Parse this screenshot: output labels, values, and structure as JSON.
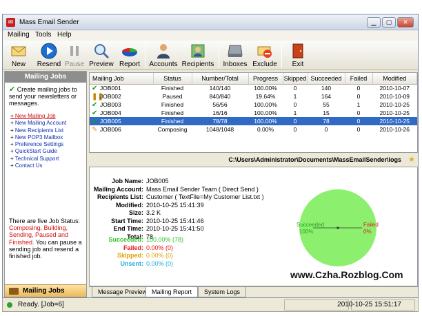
{
  "window": {
    "title": "Mass Email Sender"
  },
  "menu": [
    "Mailing",
    "Tools",
    "Help"
  ],
  "toolbar": {
    "new": "New",
    "resend": "Resend",
    "pause": "Pause",
    "preview": "Preview",
    "report": "Report",
    "accounts": "Accounts",
    "recipients": "Recipients",
    "inboxes": "Inboxes",
    "exclude": "Exclude",
    "exit": "Exit"
  },
  "left_panel": {
    "header": "Mailing Jobs",
    "intro": "Create mailing jobs to send your newsletters or messages.",
    "links": [
      "New Mailing Job",
      "New Mailing Account",
      "New Recipients List",
      "New POP3 Mailbox",
      "Preference Settings",
      "QuickStart Guide",
      "Technical Support",
      "Contact Us"
    ],
    "status_intro": "There are five Job Status:",
    "status_list": "Composing, Building, Sending, Paused and Finished.",
    "status_outro": "You can pause a sending job and resend a finished job.",
    "bottom_tab": "Mailing Jobs"
  },
  "grid": {
    "columns": [
      "Mailing Job",
      "Status",
      "Number/Total",
      "Progress",
      "Skipped",
      "Succeeded",
      "Failed",
      "Modified"
    ],
    "rows": [
      {
        "icon": "check-icon",
        "job": "JOB001",
        "status": "Finished",
        "number": "140/140",
        "progress": "100.00%",
        "skipped": "0",
        "succeeded": "140",
        "failed": "0",
        "modified": "2010-10-07"
      },
      {
        "icon": "pause-icon",
        "job": "JOB002",
        "status": "Paused",
        "number": "840/840",
        "progress": "19.64%",
        "skipped": "1",
        "succeeded": "164",
        "failed": "0",
        "modified": "2010-10-09"
      },
      {
        "icon": "check-icon",
        "job": "JOB003",
        "status": "Finished",
        "number": "56/56",
        "progress": "100.00%",
        "skipped": "0",
        "succeeded": "55",
        "failed": "1",
        "modified": "2010-10-25"
      },
      {
        "icon": "check-icon",
        "job": "JOB004",
        "status": "Finished",
        "number": "16/16",
        "progress": "100.00%",
        "skipped": "1",
        "succeeded": "15",
        "failed": "0",
        "modified": "2010-10-25"
      },
      {
        "icon": "check-icon",
        "job": "JOB005",
        "status": "Finished",
        "number": "78/78",
        "progress": "100.00%",
        "skipped": "0",
        "succeeded": "78",
        "failed": "0",
        "modified": "2010-10-25",
        "selected": true
      },
      {
        "icon": "compose-icon",
        "job": "JOB006",
        "status": "Composing",
        "number": "1048/1048",
        "progress": "0.00%",
        "skipped": "0",
        "succeeded": "0",
        "failed": "0",
        "modified": "2010-10-26"
      }
    ]
  },
  "path": "C:\\Users\\Administrator\\Documents\\MassEmailSender\\logs",
  "report": {
    "fields": [
      {
        "key": "Job Name:",
        "value": "JOB005"
      },
      {
        "key": "Mailing Account:",
        "value": "Mass Email Sender Team ( Direct Send )"
      },
      {
        "key": "Recipients List:",
        "value": "Customer ( TextFile=My Customer List.txt )"
      },
      {
        "key": "Modified:",
        "value": "2010-10-25 15:41:39"
      },
      {
        "key": "Size:",
        "value": "3.2 K"
      },
      {
        "key": "Start Time:",
        "value": "2010-10-25 15:41:46"
      },
      {
        "key": "End Time:",
        "value": "2010-10-25 15:41:50"
      },
      {
        "key": "Total:",
        "value": "78"
      }
    ],
    "stats": [
      {
        "key": "Succeeded:",
        "value": "100.00%  (78)",
        "color": "#2ec22e"
      },
      {
        "key": "Failed:",
        "value": "0.00%  (0)",
        "color": "#e01818"
      },
      {
        "key": "Skipped:",
        "value": "0.00%  (0)",
        "color": "#e0a000"
      },
      {
        "key": "Unsent:",
        "value": "0.00%  (0)",
        "color": "#20b0d8"
      }
    ],
    "pie": {
      "succeeded_label": "Succeeded",
      "succeeded_pct": "100%",
      "failed_label": "Failed",
      "failed_pct": "0%",
      "succeeded_fraction": 1.0,
      "color": "#8cf06e"
    }
  },
  "watermark": "www.Czha.Rozblog.Com",
  "tabs": [
    "Message Preview",
    "Mailing Report",
    "System Logs"
  ],
  "status": {
    "text": "Ready. [Job=6]",
    "time": "2010-10-25 15:51:17"
  }
}
